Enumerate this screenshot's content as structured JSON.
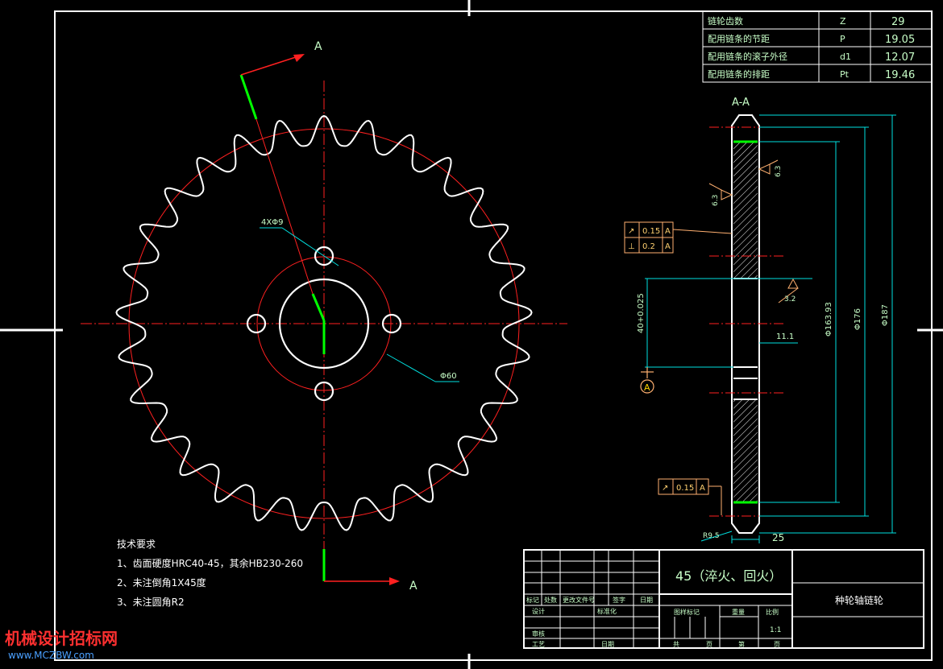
{
  "params_table": {
    "rows": [
      {
        "label": "链轮齿数",
        "symbol": "Z",
        "value": "29"
      },
      {
        "label": "配用链条的节距",
        "symbol": "P",
        "value": "19.05"
      },
      {
        "label": "配用链条的滚子外径",
        "symbol": "d1",
        "value": "12.07"
      },
      {
        "label": "配用链条的排距",
        "symbol": "Pt",
        "value": "19.46"
      }
    ]
  },
  "section_marks": {
    "cut_label": "A",
    "section_title": "A-A"
  },
  "front_view": {
    "hole_callout": "4XΦ9",
    "bolt_circle_callout": "Φ60"
  },
  "section_view": {
    "tolerance_frames": [
      {
        "symbol": "↗",
        "value": "0.15",
        "datum": "A"
      },
      {
        "symbol": "⊥",
        "value": "0.2",
        "datum": "A"
      },
      {
        "symbol": "↗",
        "value": "0.15",
        "datum": "A"
      }
    ],
    "roughness": [
      "6.3",
      "6.3",
      "3.2"
    ],
    "dims": {
      "bore": "40+0.025",
      "keyway": "11.1",
      "d_root": "Φ163.93",
      "d_hub": "Φ176",
      "d_tip": "Φ187",
      "width": "25",
      "edge_radius": "R9.5"
    },
    "datum_label": "A"
  },
  "tech_requirements": {
    "title": "技术要求",
    "items": [
      "1、齿面硬度HRC40-45，其余HB230-260",
      "2、未注倒角1X45度",
      "3、未注圆角R2"
    ]
  },
  "title_block": {
    "material": "45（淬火、回火）",
    "part_name": "种轮轴链轮",
    "scale": "1:1",
    "rev_headers": [
      "标记",
      "处数",
      "更改文件号",
      "签字",
      "日期"
    ],
    "roles": {
      "design": "设计",
      "standard": "标准化",
      "check": "审核",
      "process": "工艺",
      "date": "日期"
    },
    "stage_headers": {
      "stage": "图样标记",
      "weight": "重量",
      "scale": "比例"
    },
    "sheet": {
      "total": "共",
      "sheet": "页",
      "of": "第",
      "page": "页"
    }
  },
  "watermark": {
    "text": "机械设计招标网",
    "url": "www.MCZBW.com"
  },
  "colors": {
    "profile": "#ffffff",
    "centerline": "#ff2020",
    "dimension": "#00e0e0",
    "text_green": "#c8ffc8",
    "section_green": "#00ff00",
    "tolerance": "#ffb070",
    "watermark": "#ff3030"
  }
}
